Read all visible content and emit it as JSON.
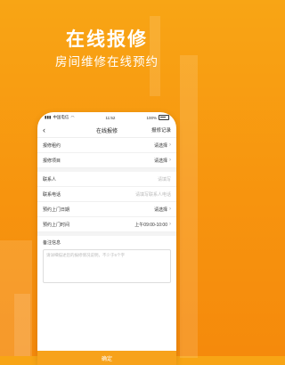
{
  "hero": {
    "title": "在线报修",
    "subtitle": "房间维修在线预约"
  },
  "phone": {
    "status_bar": {
      "carrier": "中国电信",
      "time": "11:52",
      "battery": "100%"
    },
    "nav": {
      "back_icon": "chevron-left",
      "title": "在线报修",
      "record_link": "报修记录"
    },
    "form": {
      "rows": [
        {
          "label": "报修租约",
          "value": "请选择"
        },
        {
          "label": "报修项目",
          "value": "请选择"
        },
        {
          "label": "联系人",
          "value": "请填写"
        },
        {
          "label": "联系电话",
          "value": "请填写联系人电话"
        },
        {
          "label": "预约上门日期",
          "value": "请选择"
        },
        {
          "label": "预约上门时间",
          "value": "上午09:00-10:00"
        }
      ],
      "remarks_label": "备注信息",
      "remarks_placeholder": "请详细描述您的报修情况说明，不少于5个字"
    },
    "confirm_button": "确定"
  },
  "colors": {
    "background": "#f7940e",
    "accent": "#f7a21b"
  }
}
